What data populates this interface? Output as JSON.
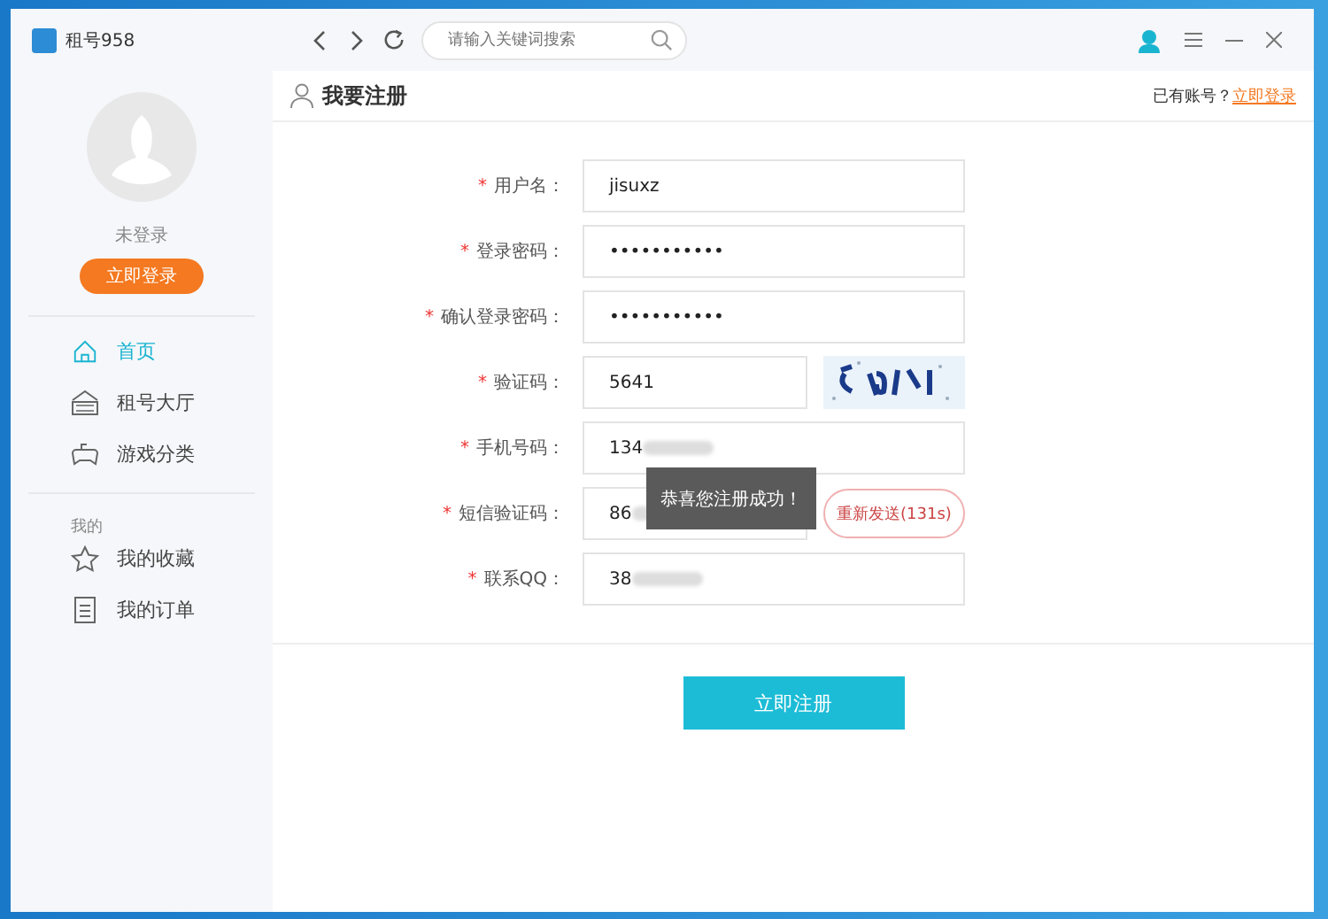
{
  "app": {
    "title": "租号958"
  },
  "search": {
    "placeholder": "请输入关键词搜索"
  },
  "user": {
    "status": "未登录",
    "login_button": "立即登录"
  },
  "nav": [
    {
      "label": "首页",
      "selected": true
    },
    {
      "label": "租号大厅",
      "selected": false
    },
    {
      "label": "游戏分类",
      "selected": false
    }
  ],
  "my_section": {
    "heading": "我的",
    "items": [
      {
        "label": "我的收藏"
      },
      {
        "label": "我的订单"
      }
    ]
  },
  "page": {
    "title": "我要注册",
    "account_prompt": "已有账号？",
    "login_link": "立即登录"
  },
  "form": [
    {
      "mark": "*",
      "label": "用户名：",
      "value": "jisuxz",
      "kind": "text"
    },
    {
      "mark": "*",
      "label": "登录密码：",
      "value": "•••••••••••",
      "kind": "text"
    },
    {
      "mark": "*",
      "label": "确认登录密码：",
      "value": "•••••••••••",
      "kind": "text"
    },
    {
      "mark": "*",
      "label": "验证码：",
      "value": "5641",
      "kind": "captcha"
    },
    {
      "mark": "*",
      "label": "手机号码：",
      "value": "134",
      "kind": "text"
    },
    {
      "mark": "*",
      "label": "短信验证码：",
      "value": "86",
      "kind": "sms",
      "button": "重新发送(131s)"
    },
    {
      "mark": "*",
      "label": "联系QQ：",
      "value": "38",
      "kind": "text"
    }
  ],
  "submit": "立即注册",
  "toast": "恭喜您注册成功！"
}
